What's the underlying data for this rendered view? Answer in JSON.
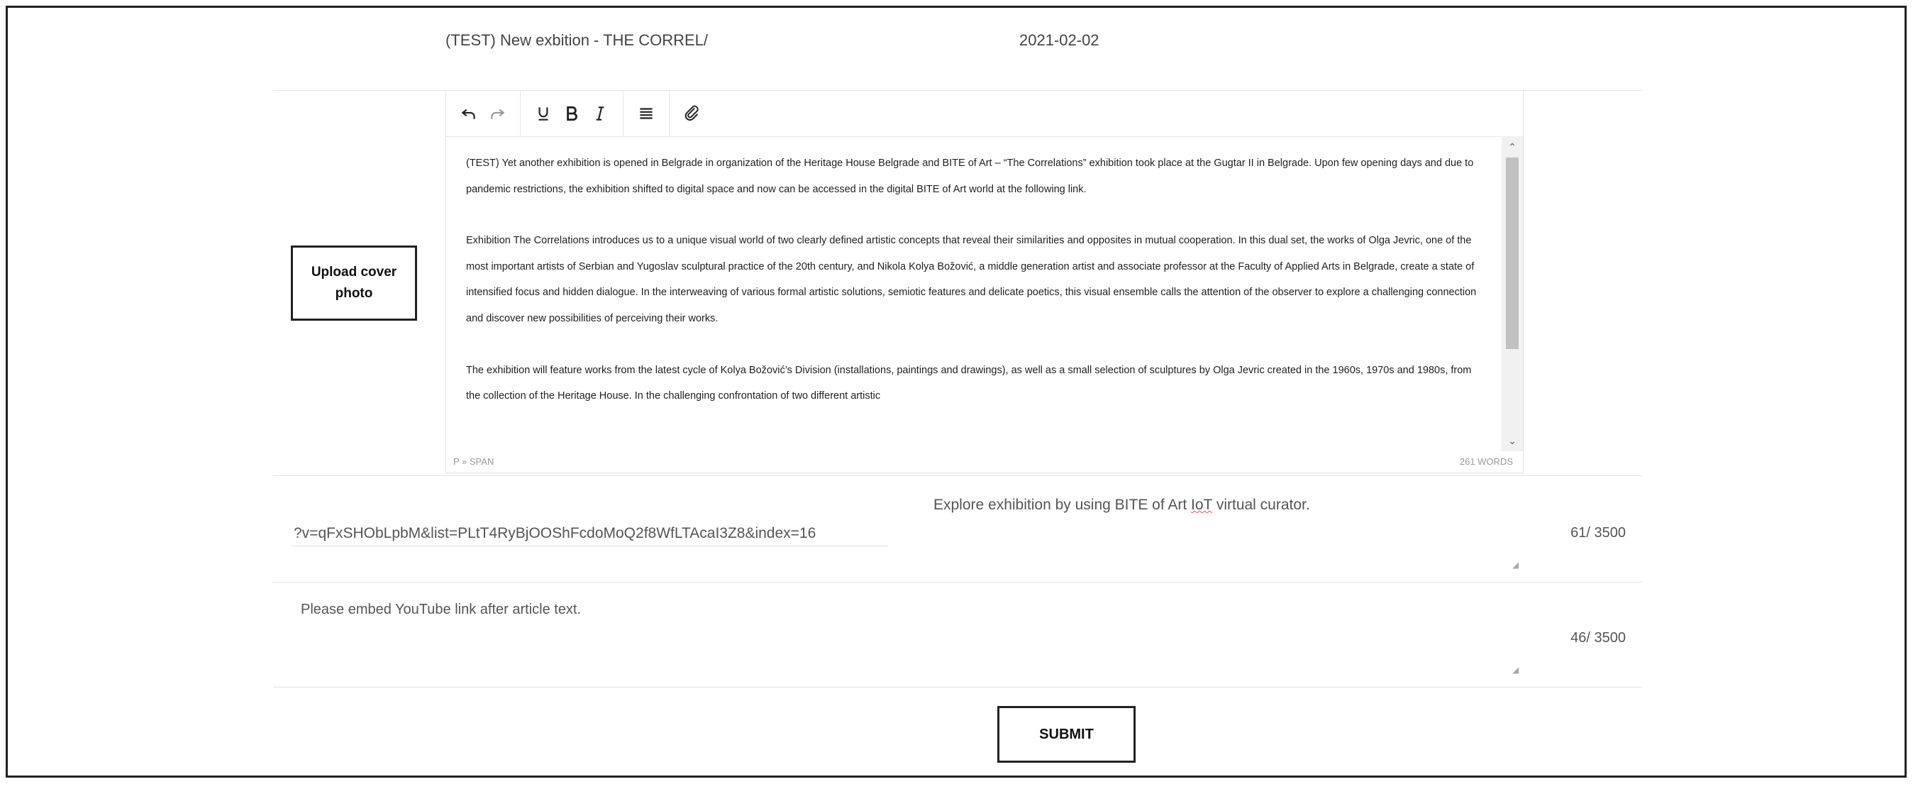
{
  "header": {
    "title": "(TEST) New exbition - THE CORREL/",
    "date": "2021-02-02"
  },
  "editor": {
    "toolbar": [
      {
        "name": "undo-icon"
      },
      {
        "name": "redo-icon"
      },
      {
        "name": "underline-icon"
      },
      {
        "name": "bold-icon"
      },
      {
        "name": "italic-icon"
      },
      {
        "name": "align-icon"
      },
      {
        "name": "link-icon"
      }
    ],
    "paragraphs": [
      "(TEST) Yet another exhibition is opened in Belgrade in organization of the Heritage House Belgrade and BITE of Art – “The Correlations” exhibition took place at the Gugtar II in Belgrade. Upon few opening days and due to pandemic restrictions, the exhibition shifted to digital space and now can be accessed in the digital BITE of Art world at the following link.",
      "Exhibition The Correlations introduces us to a unique visual world of two clearly defined artistic concepts that reveal their similarities and opposites in mutual cooperation. In this dual set, the works of Olga Jevric, one of the most important artists of Serbian and Yugoslav sculptural practice of the 20th century, and Nikola Kolya Božović, a middle generation artist and associate professor at the Faculty of Applied Arts in Belgrade, create a state of intensified focus and hidden dialogue. In the interweaving of various formal artistic solutions, semiotic features and delicate poetics, this visual ensemble calls the attention of the observer to explore a challenging connection and discover new possibilities of perceiving their works.",
      "The exhibition will feature works from the latest cycle of Kolya Božović’s Division (installations, paintings and drawings), as well as a small selection of sculptures by Olga Jevric created in the 1960s, 1970s and 1980s, from the collection of the Heritage House. In the challenging confrontation of two different artistic"
    ],
    "status_left": "P » SPAN",
    "status_right": "261 WORDS"
  },
  "upload": {
    "label": "Upload cover photo"
  },
  "link_field": {
    "value": "?v=qFxSHObLpbM&list=PLtT4RyBjOOShFcdoMoQ2f8WfLTAcaI3Z8&index=16",
    "description_pre": "Explore exhibition by using BITE of Art ",
    "description_iot": "IoT",
    "description_post": " virtual curator.",
    "counter": "61/ 3500"
  },
  "note_field": {
    "value": "Please embed YouTube link after article text.",
    "counter": "46/ 3500"
  },
  "submit": {
    "label": "SUBMIT"
  }
}
